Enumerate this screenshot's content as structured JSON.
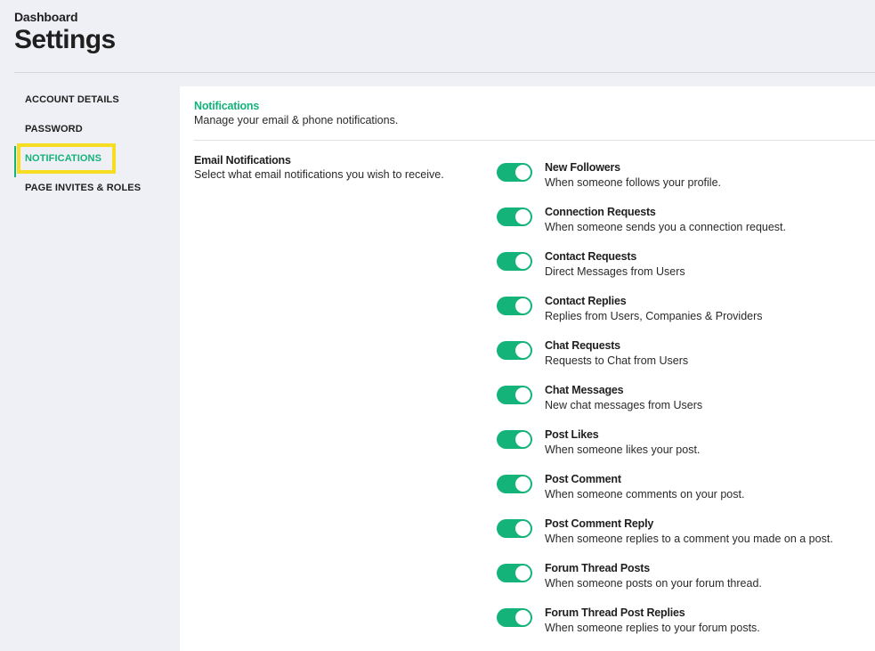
{
  "header": {
    "breadcrumb": "Dashboard",
    "title": "Settings"
  },
  "sidebar": {
    "items": [
      {
        "label": "ACCOUNT DETAILS",
        "active": false
      },
      {
        "label": "PASSWORD",
        "active": false
      },
      {
        "label": "NOTIFICATIONS",
        "active": true
      },
      {
        "label": "PAGE INVITES & ROLES",
        "active": false
      }
    ]
  },
  "panel": {
    "title": "Notifications",
    "subtitle": "Manage your email & phone notifications.",
    "section": {
      "title": "Email Notifications",
      "description": "Select what email notifications you wish to receive."
    },
    "options": [
      {
        "title": "New Followers",
        "description": "When someone follows your profile.",
        "enabled": true
      },
      {
        "title": "Connection Requests",
        "description": "When someone sends you a connection request.",
        "enabled": true
      },
      {
        "title": "Contact Requests",
        "description": "Direct Messages from Users",
        "enabled": true
      },
      {
        "title": "Contact Replies",
        "description": "Replies from Users, Companies & Providers",
        "enabled": true
      },
      {
        "title": "Chat Requests",
        "description": "Requests to Chat from Users",
        "enabled": true
      },
      {
        "title": "Chat Messages",
        "description": "New chat messages from Users",
        "enabled": true
      },
      {
        "title": "Post Likes",
        "description": "When someone likes your post.",
        "enabled": true
      },
      {
        "title": "Post Comment",
        "description": "When someone comments on your post.",
        "enabled": true
      },
      {
        "title": "Post Comment Reply",
        "description": "When someone replies to a comment you made on a post.",
        "enabled": true
      },
      {
        "title": "Forum Thread Posts",
        "description": "When someone posts on your forum thread.",
        "enabled": true
      },
      {
        "title": "Forum Thread Post Replies",
        "description": "When someone replies to your forum posts.",
        "enabled": true
      }
    ]
  },
  "colors": {
    "accent": "#14b37a",
    "highlight": "#f7dd21",
    "background": "#eff0f5"
  }
}
